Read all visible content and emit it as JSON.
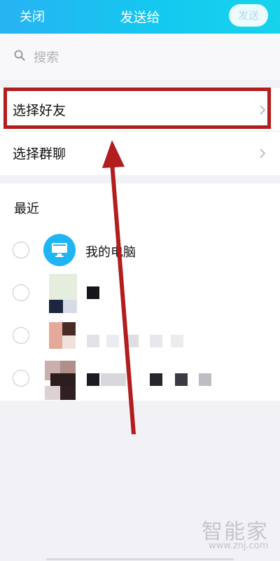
{
  "header": {
    "close_label": "关闭",
    "title": "发送给",
    "send_label": "发送"
  },
  "search": {
    "placeholder": "搜索"
  },
  "menu": {
    "items": [
      {
        "label": "选择好友"
      },
      {
        "label": "选择群聊"
      }
    ]
  },
  "recent": {
    "title": "最近",
    "contacts": [
      {
        "name": "我的电脑",
        "avatar": "computer-icon"
      }
    ]
  },
  "watermark": {
    "brand": "智能家",
    "url": "www.znj.com"
  },
  "colors": {
    "header_gradient_start": "#27b3f3",
    "header_gradient_end": "#17d3ec",
    "highlight_border": "#b21d1d",
    "arrow": "#b21d1d",
    "avatar_bg": "#1fb4f2"
  }
}
